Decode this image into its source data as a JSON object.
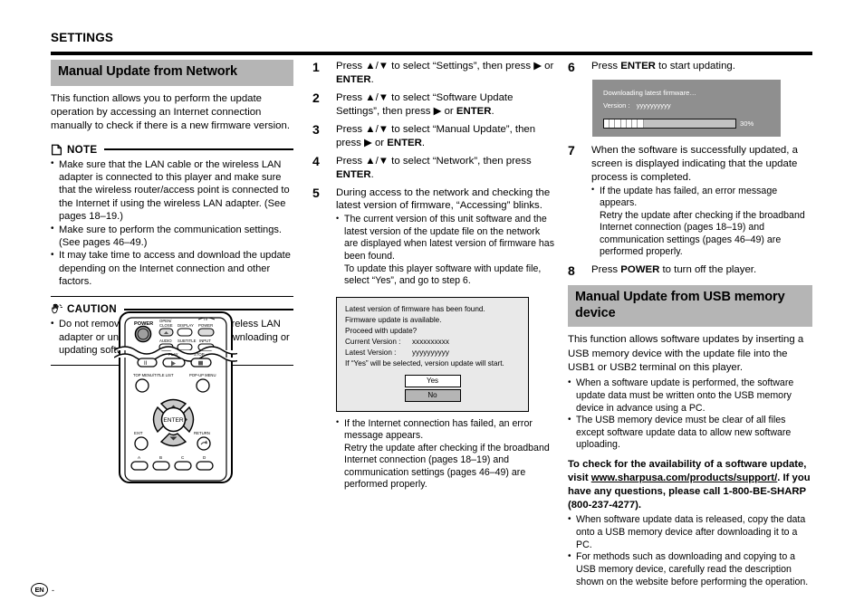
{
  "running_head": "SETTINGS",
  "footer": {
    "language_badge": "EN",
    "page_marker": "-"
  },
  "left_column": {
    "section_title": "Manual Update from Network",
    "intro": "This function allows you to perform the update operation by accessing an Internet connection manually to check if there is a new firmware version.",
    "note": {
      "icon": "note-page-icon",
      "label": "NOTE",
      "items": [
        "Make sure that the LAN cable or the wireless LAN adapter is connected to this player and make sure that the wireless router/access point is connected to the Internet if using the wireless LAN adapter. (See pages 18–19.)",
        "Make sure to perform the communication settings. (See pages 46–49.)",
        "It may take time to access and download the update depending on the Internet connection and other factors."
      ]
    },
    "caution": {
      "icon": "caution-hand-icon",
      "label": "CAUTION",
      "items": [
        "Do not remove the LAN cable or the wireless LAN adapter or unplug the AC cord while downloading or updating software."
      ]
    },
    "remote_illustration": {
      "name": "remote-control-illustration",
      "labels": {
        "power": "POWER",
        "open_close": "OPEN/\nCLOSE",
        "display": "DISPLAY",
        "tv": "TV",
        "tv_power": "POWER",
        "audio": "AUDIO",
        "subtitle": "SUBTITLE",
        "input": "INPUT",
        "play": "PLAY",
        "stop": "STOP",
        "top_menu": "TOP MENU/TITLE LIST",
        "popup_menu": "POP-UP MENU",
        "enter": "ENTER",
        "exit": "EXIT",
        "return": "RETURN",
        "color_a": "A",
        "color_b": "B",
        "color_c": "C",
        "color_d": "D"
      }
    }
  },
  "middle_column": {
    "steps": [
      {
        "num": "1",
        "text_parts": [
          {
            "t": "Press ",
            "b": false
          },
          {
            "t": "▲",
            "b": false
          },
          {
            "t": "/",
            "b": false
          },
          {
            "t": "▼",
            "b": false
          },
          {
            "t": " to select “Settings”, then press ",
            "b": false
          },
          {
            "t": "▶",
            "b": false
          },
          {
            "t": " or ",
            "b": false
          },
          {
            "t": "ENTER",
            "b": true
          },
          {
            "t": ".",
            "b": false
          }
        ]
      },
      {
        "num": "2",
        "text_parts": [
          {
            "t": "Press ",
            "b": false
          },
          {
            "t": "▲",
            "b": false
          },
          {
            "t": "/",
            "b": false
          },
          {
            "t": "▼",
            "b": false
          },
          {
            "t": " to select “Software Update Settings”, then press ",
            "b": false
          },
          {
            "t": "▶",
            "b": false
          },
          {
            "t": " or ",
            "b": false
          },
          {
            "t": "ENTER",
            "b": true
          },
          {
            "t": ".",
            "b": false
          }
        ]
      },
      {
        "num": "3",
        "text_parts": [
          {
            "t": "Press ",
            "b": false
          },
          {
            "t": "▲",
            "b": false
          },
          {
            "t": "/",
            "b": false
          },
          {
            "t": "▼",
            "b": false
          },
          {
            "t": " to select “Manual Update”, then press ",
            "b": false
          },
          {
            "t": "▶",
            "b": false
          },
          {
            "t": " or ",
            "b": false
          },
          {
            "t": "ENTER",
            "b": true
          },
          {
            "t": ".",
            "b": false
          }
        ]
      },
      {
        "num": "4",
        "text_parts": [
          {
            "t": "Press ",
            "b": false
          },
          {
            "t": "▲",
            "b": false
          },
          {
            "t": "/",
            "b": false
          },
          {
            "t": "▼",
            "b": false
          },
          {
            "t": " to select “Network”, then press ",
            "b": false
          },
          {
            "t": "ENTER",
            "b": true
          },
          {
            "t": ".",
            "b": false
          }
        ]
      },
      {
        "num": "5",
        "text_parts": [
          {
            "t": "During access to the network and checking the latest version of firmware, “Accessing” blinks.",
            "b": false
          }
        ]
      }
    ],
    "step5_bullets": [
      {
        "main": "The current version of this unit software and the latest version of the update file on the network are displayed when latest version of firmware has been found.",
        "cont": "To update this player software with update file, select “Yes”, and go to step 6."
      }
    ],
    "dialog_found": {
      "line1": "Latest version of firmware has been found.",
      "line2": "Firmware update is available.",
      "line3": "Proceed with update?",
      "current_version_label": "Current Version :",
      "current_version_value": "xxxxxxxxxx",
      "latest_version_label": "Latest Version  :",
      "latest_version_value": "yyyyyyyyyy",
      "line6": "If “Yes” will be selected, version update will start.",
      "button_yes": "Yes",
      "button_no": "No"
    },
    "after_dialog_bullets": [
      {
        "main": "If the Internet connection has failed, an error message appears.",
        "cont": "Retry the update after checking if the broadband Internet connection (pages 18–19) and communication settings (pages 46–49) are performed properly."
      }
    ]
  },
  "right_column": {
    "step6": {
      "num": "6",
      "text_parts": [
        {
          "t": "Press ",
          "b": false
        },
        {
          "t": "ENTER",
          "b": true
        },
        {
          "t": " to start updating.",
          "b": false
        }
      ]
    },
    "dialog_download": {
      "line1": "Downloading latest firmware…",
      "version_label": "Version :",
      "version_value": "yyyyyyyyyy",
      "progress_percent": "30%",
      "progress_value": 30
    },
    "step7": {
      "num": "7",
      "text": "When the software is successfully updated, a screen is displayed indicating that the update process is completed.",
      "bullets": [
        {
          "main": "If the update has failed, an error message appears.",
          "cont": "Retry the update after checking if the broadband Internet connection (pages 18–19) and communication settings (pages 46–49) are performed properly."
        }
      ]
    },
    "step8": {
      "num": "8",
      "text_parts": [
        {
          "t": "Press ",
          "b": false
        },
        {
          "t": "POWER",
          "b": true
        },
        {
          "t": " to turn off the player.",
          "b": false
        }
      ]
    },
    "section_title": "Manual Update from USB memory device",
    "intro": "This function allows software updates by inserting a USB memory device with the update file into the USB1 or USB2 terminal on this player.",
    "intro_bullets": [
      "When a software update is performed, the software update data must be written onto the USB memory device in advance using a PC.",
      "The USB memory device must be clear of all files except software update data to allow new software uploading."
    ],
    "lead_bold": {
      "pre": "To check for the availability of a software update, visit ",
      "url": "www.sharpusa.com/products/support/",
      "post": ". If you have any questions, please call 1-800-BE-SHARP (800-237-4277)."
    },
    "tail_bullets": [
      "When software update data is released, copy the data onto a USB memory device after downloading it to a PC.",
      "For methods such as downloading and copying to a USB memory device, carefully read the description shown on the website before performing the operation."
    ]
  }
}
